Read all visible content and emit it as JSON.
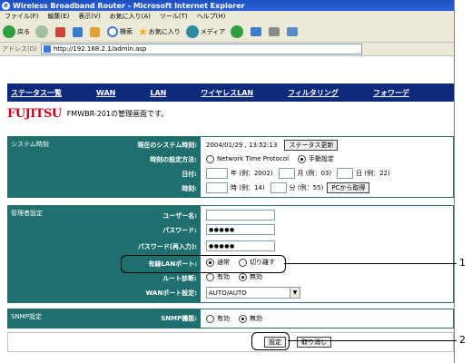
{
  "window": {
    "title": "Wireless Broadband Router - Microsoft Internet Explorer"
  },
  "menu": [
    "ファイル(F)",
    "編集(E)",
    "表示(V)",
    "お気に入り(A)",
    "ツール(T)",
    "ヘルプ(H)"
  ],
  "toolbar": {
    "back": "戻る",
    "search": "検索",
    "favorites": "お気に入り",
    "media": "メディア"
  },
  "address": {
    "label": "アドレス(D)",
    "url": "http://192.168.2.1/admin.asp"
  },
  "nav": [
    "ステータス一覧",
    "WAN",
    "LAN",
    "ワイヤレスLAN",
    "フィルタリング",
    "フォワーデ"
  ],
  "header": {
    "logo": "FUJITSU",
    "desc": "FMWBR-201の管理画面です。"
  },
  "system_time": {
    "section": "システム時刻",
    "current_label": "現在のシステム時刻:",
    "current_value": "2004/01/29 , 13:52:13",
    "status_button": "ステータス更新",
    "method_label": "時刻の設定方法:",
    "ntp_option": "Network Time Protocol",
    "manual_option": "手動設定",
    "date_label": "日付:",
    "year_hint": "年 (例：2002)",
    "month_hint": "月 (例：03)",
    "day_hint": "日 (例：22)",
    "time_label": "時刻:",
    "hour_hint": "時 (例：14)",
    "minute_hint": "分 (例：55)",
    "pc_button": "PCから取得"
  },
  "admin": {
    "section": "管理者設定",
    "user_label": "ユーザー名:",
    "password_label": "パスワード:",
    "password_value": "●●●●●",
    "password_confirm_label": "パスワード(再入力):",
    "password_confirm_value": "●●●●●",
    "wired_lan_label": "有線LANポート:",
    "wired_normal": "通常",
    "wired_disconnect": "切り離す",
    "route_label": "ルート診断:",
    "route_enable": "有効",
    "route_disable": "無効",
    "wan_port_label": "WANポート設定:",
    "wan_port_value": "AUTO/AUTO"
  },
  "snmp": {
    "section": "SNMP設定",
    "label": "SNMP機能:",
    "enable": "有効",
    "disable": "無効"
  },
  "actions": {
    "submit": "設定",
    "cancel": "取り消し"
  },
  "callouts": {
    "one": "1",
    "two": "2"
  }
}
